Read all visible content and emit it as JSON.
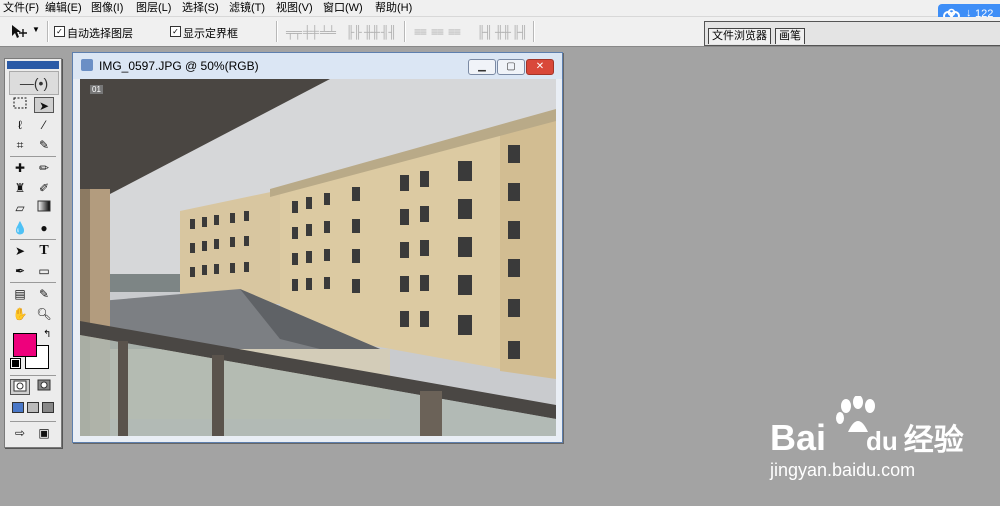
{
  "menubar": {
    "items": [
      {
        "label": "文件(F)"
      },
      {
        "label": "编辑(E)"
      },
      {
        "label": "图像(I)"
      },
      {
        "label": "图层(L)"
      },
      {
        "label": "选择(S)"
      },
      {
        "label": "滤镜(T)"
      },
      {
        "label": "视图(V)"
      },
      {
        "label": "窗口(W)"
      },
      {
        "label": "帮助(H)"
      }
    ]
  },
  "options": {
    "auto_select_label": "自动选择图层",
    "show_bounds_label": "显示定界框",
    "auto_select_checked": true,
    "show_bounds_checked": true
  },
  "palette_well": {
    "tabs": [
      "文件浏览器",
      "画笔"
    ]
  },
  "cloud_badge": {
    "count": "122",
    "icon": "baidu-cloud-icon"
  },
  "toolbox": {
    "foreground_color": "#ee007c",
    "background_color": "#ffffff"
  },
  "document": {
    "title": "IMG_0597.JPG @ 50%(RGB)",
    "badge": "01"
  },
  "watermark": {
    "brand_prefix": "Bai",
    "brand_mid": "du",
    "brand_suffix": "经验",
    "url": "jingyan.baidu.com"
  }
}
